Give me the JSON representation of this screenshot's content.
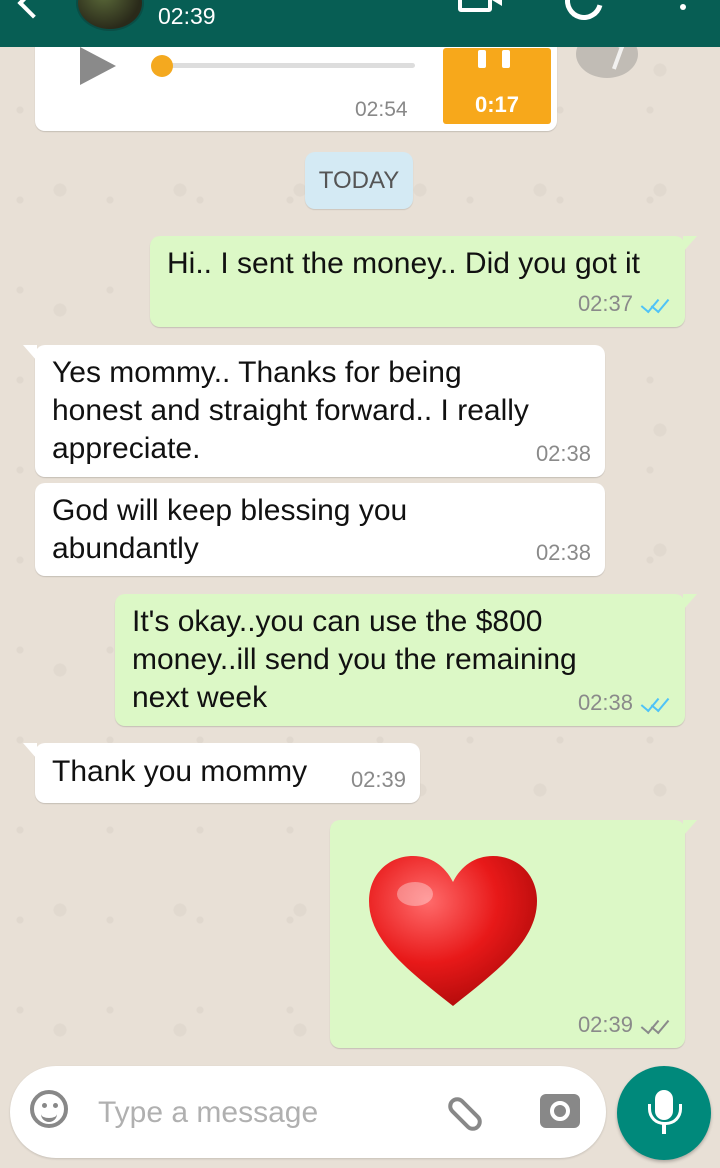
{
  "header": {
    "status_time": "02:39"
  },
  "voice_message": {
    "time": "02:54",
    "duration": "0:17"
  },
  "date_chip": "TODAY",
  "messages": [
    {
      "direction": "out",
      "text": "Hi.. I sent the money.. Did you got it",
      "time": "02:37",
      "status": "read"
    },
    {
      "direction": "in",
      "text": "Yes mommy.. Thanks for being\nhonest and straight forward.. I really\nappreciate.",
      "time": "02:38"
    },
    {
      "direction": "in",
      "text": "God will keep blessing you\nabundantly",
      "time": "02:38"
    },
    {
      "direction": "out",
      "text": "It's okay..you can use the $800\nmoney..ill send you the remaining\nnext week",
      "time": "02:38",
      "status": "read"
    },
    {
      "direction": "in",
      "text": "Thank you mommy",
      "time": "02:39"
    },
    {
      "direction": "out",
      "sticker": "red-heart",
      "time": "02:39",
      "status": "delivered"
    }
  ],
  "composer": {
    "placeholder": "Type a message"
  },
  "colors": {
    "header": "#075e54",
    "outgoing": "#dcf8c6",
    "incoming": "#ffffff",
    "read_ticks": "#4fc3f7",
    "delivered_ticks": "#8a8a8a",
    "voice_badge": "#f7a81b",
    "mic_button": "#00897b"
  }
}
